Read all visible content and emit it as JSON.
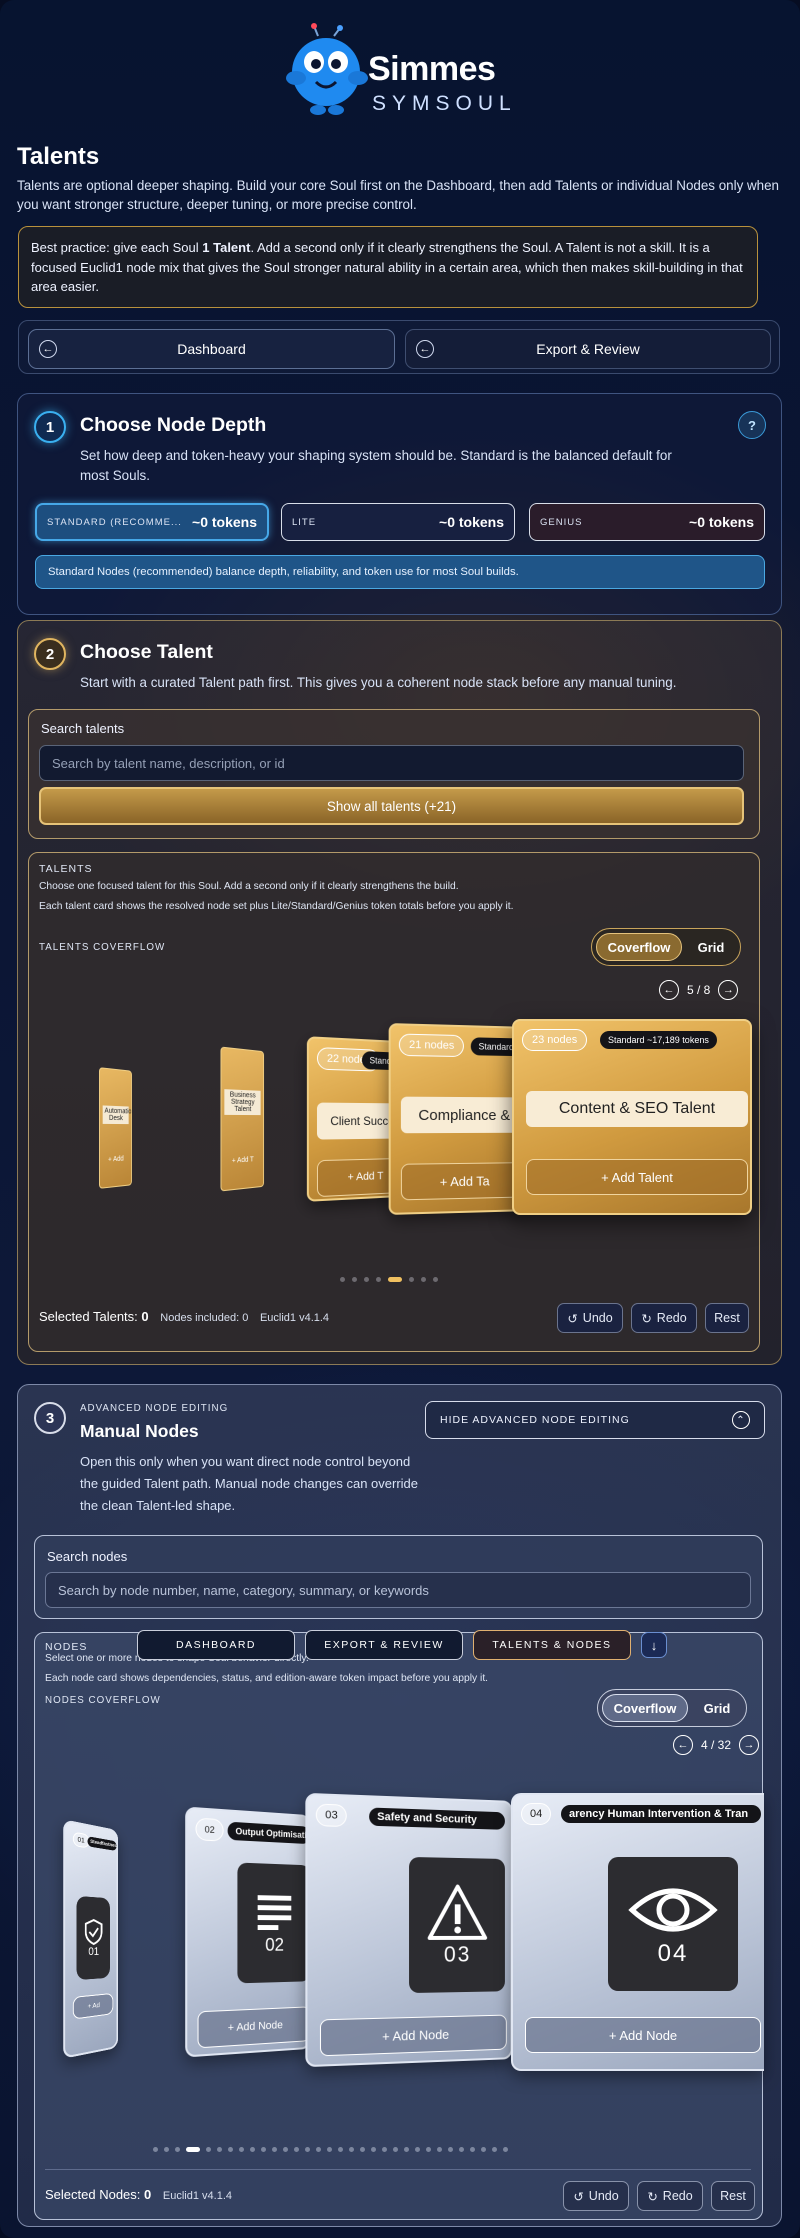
{
  "brand": {
    "name": "Simmes",
    "sub": "SYMSOUL"
  },
  "page": {
    "title": "Talents",
    "intro": "Talents are optional deeper shaping. Build your core Soul first on the Dashboard, then add Talents or individual Nodes only when you want stronger structure, deeper tuning, or more precise control.",
    "tip_before": "Best practice: give each Soul ",
    "tip_bold": "1 Talent",
    "tip_after": ". Add a second only if it clearly strengthens the Soul. A Talent is not a skill. It is a focused Euclid1 node mix that gives the Soul stronger natural ability in a certain area, which then makes skill-building in that area easier."
  },
  "nav": {
    "dashboard": "Dashboard",
    "export": "Export & Review"
  },
  "step1": {
    "num": "1",
    "title": "Choose Node Depth",
    "desc": "Set how deep and token-heavy your shaping system should be. Standard is the balanced default for most Souls.",
    "help": "?",
    "tiers": [
      {
        "label": "STANDARD (RECOMME...",
        "tokens": "~0 tokens"
      },
      {
        "label": "LITE",
        "tokens": "~0 tokens"
      },
      {
        "label": "GENIUS",
        "tokens": "~0 tokens"
      }
    ],
    "note": "Standard Nodes (recommended) balance depth, reliability, and token use for most Soul builds."
  },
  "step2": {
    "num": "2",
    "title": "Choose Talent",
    "desc": "Start with a curated Talent path first. This gives you a coherent node stack before any manual tuning.",
    "search_label": "Search talents",
    "search_placeholder": "Search by talent name, description, or id",
    "show_all": "Show all talents (+21)",
    "panel_title": "TALENTS",
    "panel_line1": "Choose one focused talent for this Soul. Add a second only if it clearly strengthens the build.",
    "panel_line2": "Each talent card shows the resolved node set plus Lite/Standard/Genius token totals before you apply it.",
    "coverflow_label": "TALENTS COVERFLOW",
    "view_coverflow": "Coverflow",
    "view_grid": "Grid",
    "pager": "5 / 8",
    "cards": [
      {
        "nodes": "22 nodes",
        "tokens": "Standard ~",
        "name": "Client Succes",
        "add": "+ Add T"
      },
      {
        "nodes": "21 nodes",
        "tokens": "Standard",
        "name": "Compliance &",
        "add": "+ Add Ta"
      },
      {
        "nodes": "23 nodes",
        "tokens": "Standard ~17,189 tokens",
        "name": "Content & SEO Talent",
        "add": "+ Add Talent"
      }
    ],
    "mini": [
      {
        "name": "Automation Desk",
        "add": "+ Add"
      },
      {
        "name": "Business Strategy Talent",
        "add": "+ Add T"
      }
    ],
    "footer": {
      "selected_label": "Selected Talents:",
      "selected": "0",
      "nodes": "Nodes included: 0",
      "version": "Euclid1 v4.1.4"
    },
    "undo": "Undo",
    "redo": "Redo",
    "reset": "Rest"
  },
  "step3": {
    "num": "3",
    "kicker": "ADVANCED NODE EDITING",
    "title": "Manual Nodes",
    "desc": "Open this only when you want direct node control beyond the guided Talent path. Manual node changes can override the clean Talent-led shape.",
    "hide": "HIDE ADVANCED NODE EDITING",
    "search_label": "Search nodes",
    "search_placeholder": "Search by node number, name, category, summary, or keywords",
    "panel_title": "NODES",
    "panel_line1": "Select one or more nodes to shape Soul behavior directly.",
    "panel_line2": "Each node card shows dependencies, status, and edition-aware token impact before you apply it.",
    "coverflow_label": "NODES COVERFLOW",
    "view_coverflow": "Coverflow",
    "view_grid": "Grid",
    "pager": "4 / 32",
    "floatnav": {
      "dashboard": "DASHBOARD",
      "export": "EXPORT & REVIEW",
      "talents": "TALENTS & NODES"
    },
    "cards": [
      {
        "num": "01",
        "cat": "Steadfastness",
        "digit": "01",
        "add": "+ Ad",
        "icon": "shield-icon"
      },
      {
        "num": "02",
        "cat": "Output Optimisation",
        "digit": "02",
        "add": "+ Add Node",
        "icon": "list-icon"
      },
      {
        "num": "03",
        "cat": "Safety and Security",
        "digit": "03",
        "add": "+ Add Node",
        "icon": "warning-icon"
      },
      {
        "num": "04",
        "cat": "arency  Human Intervention & Tran",
        "digit": "04",
        "add": "+ Add Node",
        "icon": "eye-icon"
      }
    ],
    "footer": {
      "selected_label": "Selected Nodes:",
      "selected": "0",
      "version": "Euclid1 v4.1.4"
    },
    "undo": "Undo",
    "redo": "Redo",
    "reset": "Rest"
  }
}
